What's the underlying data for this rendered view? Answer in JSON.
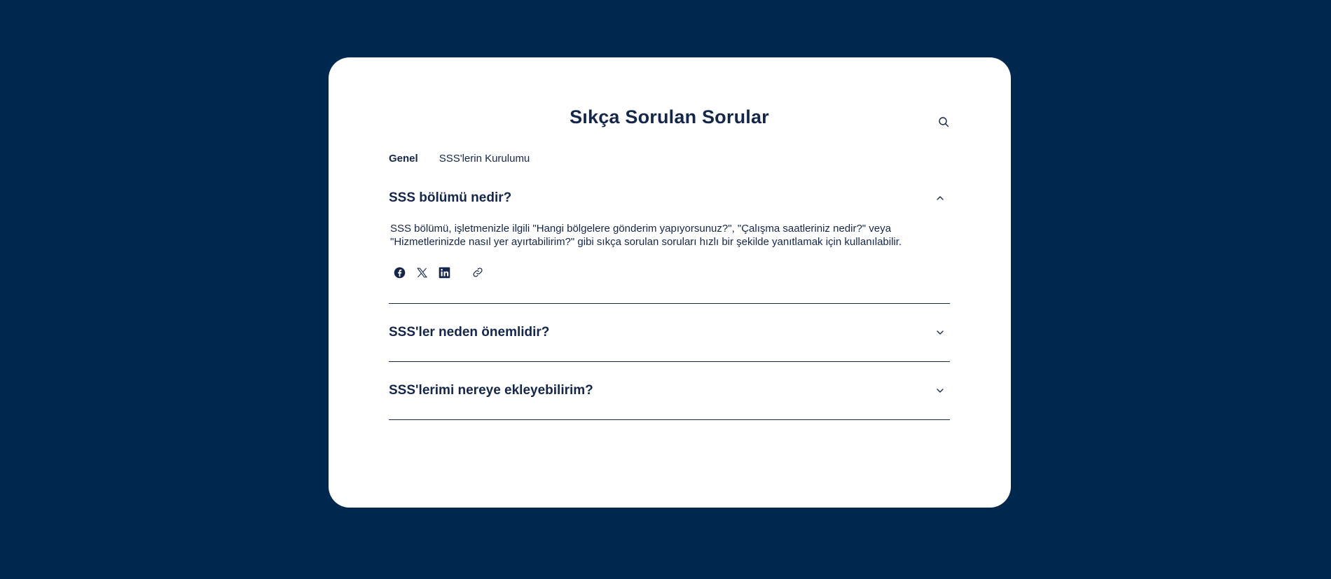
{
  "page": {
    "title": "Sıkça Sorulan Sorular"
  },
  "tabs": [
    {
      "label": "Genel",
      "active": true
    },
    {
      "label": "SSS'lerin Kurulumu",
      "active": false
    }
  ],
  "faqs": [
    {
      "question": "SSS bölümü nedir?",
      "expanded": true,
      "answer": "SSS bölümü, işletmenizle ilgili \"Hangi bölgelere gönderim yapıyorsunuz?\", \"Çalışma saatleriniz nedir?\" veya \"Hizmetlerinizde nasıl yer ayırtabilirim?\" gibi sıkça sorulan soruları hızlı bir şekilde yanıtlamak için kullanılabilir."
    },
    {
      "question": "SSS'ler neden önemlidir?",
      "expanded": false
    },
    {
      "question": "SSS'lerimi nereye ekleyebilirim?",
      "expanded": false
    }
  ],
  "share_icons": [
    "facebook-icon",
    "x-twitter-icon",
    "linkedin-icon",
    "link-icon"
  ],
  "icons": {
    "search": "search-icon",
    "chevron_up": "chevron-up-icon",
    "chevron_down": "chevron-down-icon"
  },
  "colors": {
    "background": "#00284f",
    "card": "#ffffff",
    "text": "#14264a"
  }
}
